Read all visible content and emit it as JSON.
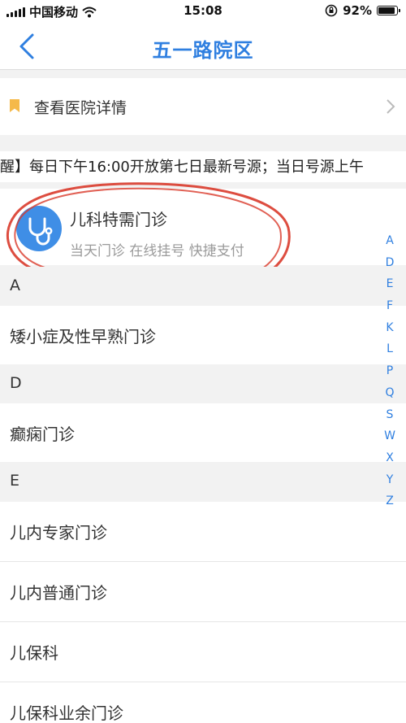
{
  "status_bar": {
    "carrier": "中国移动",
    "time": "15:08",
    "battery": "92%",
    "battery_level": 0.92
  },
  "nav": {
    "title": "五一路院区"
  },
  "hospital_detail": {
    "label": "查看医院详情"
  },
  "notice": {
    "text": "醒】每日下午16:00开放第七日最新号源；当日号源上午"
  },
  "featured_service": {
    "name": "儿科特需门诊",
    "subtitle": "当天门诊 在线挂号 快捷支付"
  },
  "sections": [
    {
      "letter": "A",
      "departments": [
        "矮小症及性早熟门诊"
      ]
    },
    {
      "letter": "D",
      "departments": [
        "癫痫门诊"
      ]
    },
    {
      "letter": "E",
      "departments": [
        "儿内专家门诊",
        "儿内普通门诊",
        "儿保科",
        "儿保科业余门诊"
      ]
    }
  ],
  "index_letters": [
    "A",
    "D",
    "E",
    "F",
    "K",
    "L",
    "P",
    "Q",
    "S",
    "W",
    "X",
    "Y",
    "Z"
  ],
  "colors": {
    "accent": "#2f7fe0",
    "icon_bg": "#3f8ee6",
    "bookmark": "#f5b94a",
    "annotation": "#d93a2b"
  }
}
